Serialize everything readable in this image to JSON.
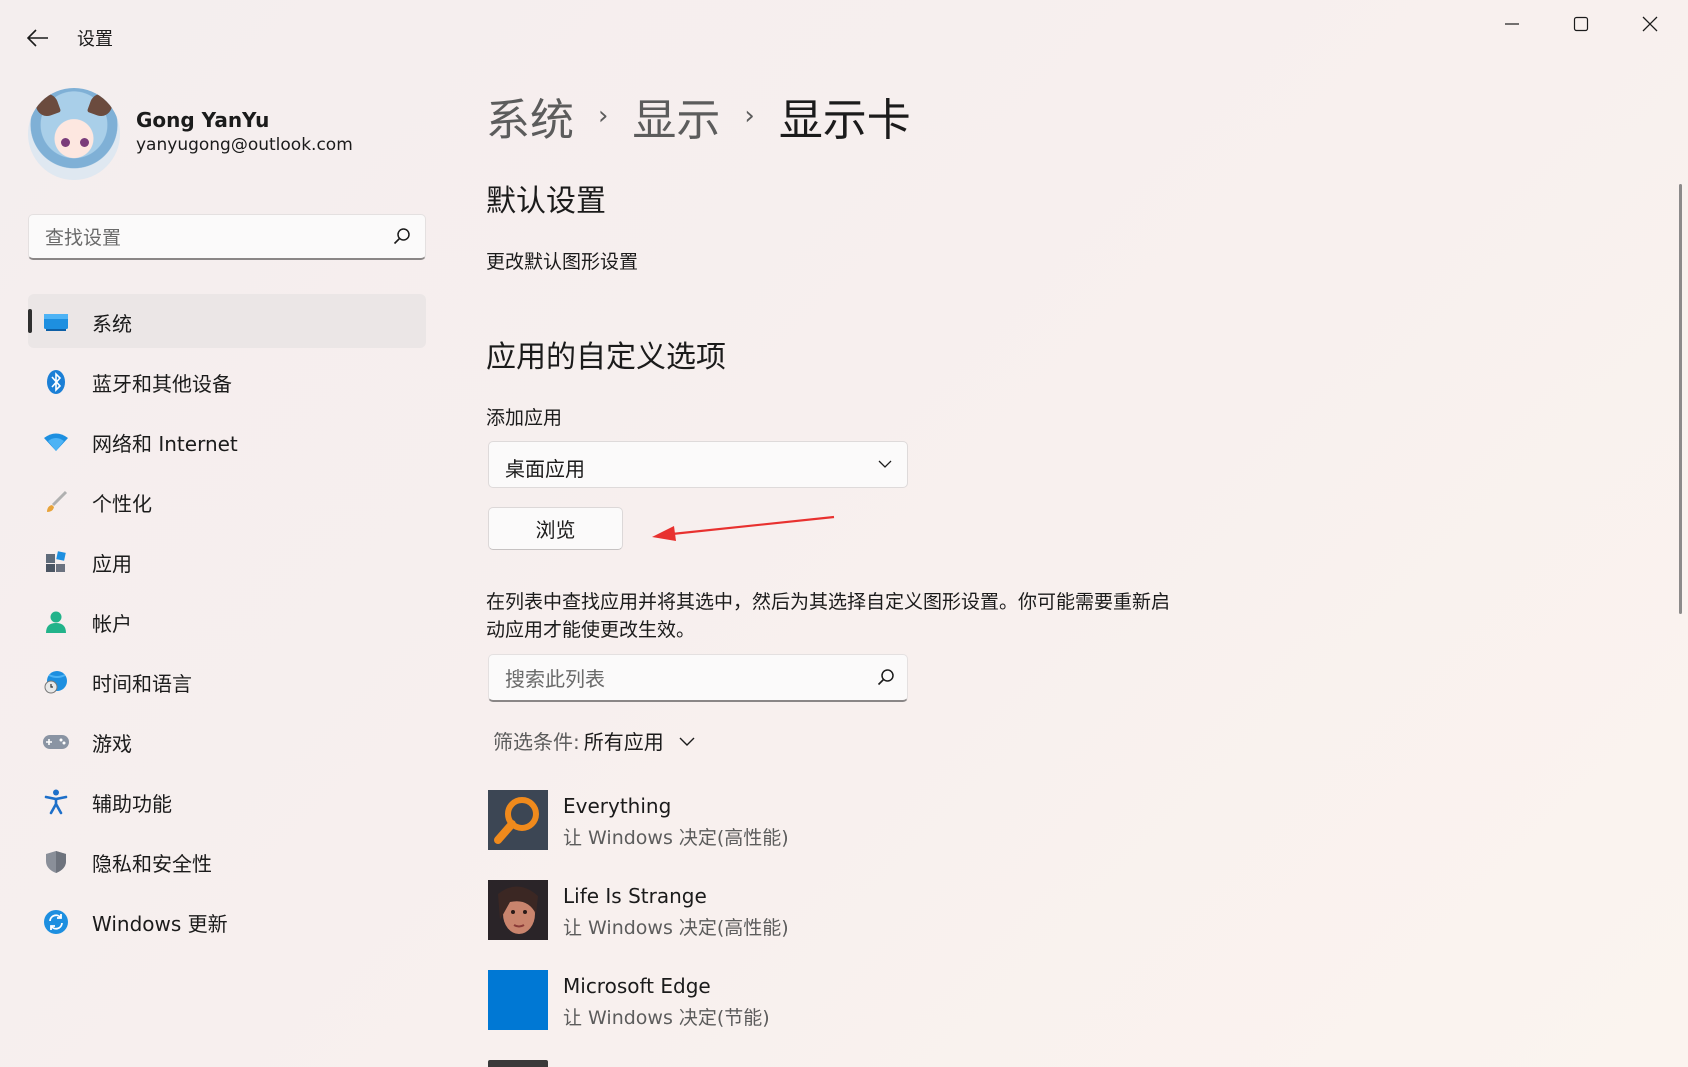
{
  "window": {
    "title": "设置"
  },
  "profile": {
    "name": "Gong YanYu",
    "email": "yanyugong@outlook.com"
  },
  "search": {
    "placeholder": "查找设置"
  },
  "sidebar": {
    "items": [
      {
        "label": "系统",
        "icon": "monitor-icon",
        "active": true
      },
      {
        "label": "蓝牙和其他设备",
        "icon": "bluetooth-icon"
      },
      {
        "label": "网络和 Internet",
        "icon": "wifi-icon"
      },
      {
        "label": "个性化",
        "icon": "brush-icon"
      },
      {
        "label": "应用",
        "icon": "apps-icon"
      },
      {
        "label": "帐户",
        "icon": "account-icon"
      },
      {
        "label": "时间和语言",
        "icon": "globe-clock-icon"
      },
      {
        "label": "游戏",
        "icon": "gamepad-icon"
      },
      {
        "label": "辅助功能",
        "icon": "accessibility-icon"
      },
      {
        "label": "隐私和安全性",
        "icon": "shield-icon"
      },
      {
        "label": "Windows 更新",
        "icon": "update-icon"
      }
    ]
  },
  "breadcrumb": [
    "系统",
    "显示",
    "显示卡"
  ],
  "main": {
    "default_settings_heading": "默认设置",
    "change_default_link": "更改默认图形设置",
    "custom_options_heading": "应用的自定义选项",
    "add_app_label": "添加应用",
    "app_type_selected": "桌面应用",
    "browse_label": "浏览",
    "description": "在列表中查找应用并将其选中，然后为其选择自定义图形设置。你可能需要重新启动应用才能使更改生效。",
    "list_search_placeholder": "搜索此列表",
    "filter_label": "筛选条件:",
    "filter_value": "所有应用"
  },
  "apps": [
    {
      "name": "Everything",
      "status": "让 Windows 决定(高性能)",
      "icon": "everything-app-icon"
    },
    {
      "name": "Life Is Strange",
      "status": "让 Windows 决定(高性能)",
      "icon": "life-is-strange-app-icon"
    },
    {
      "name": "Microsoft Edge",
      "status": "让 Windows 决定(节能)",
      "icon": "edge-app-icon"
    }
  ],
  "colors": {
    "accent": "#0078d4",
    "annotation_arrow": "#e8312f"
  }
}
